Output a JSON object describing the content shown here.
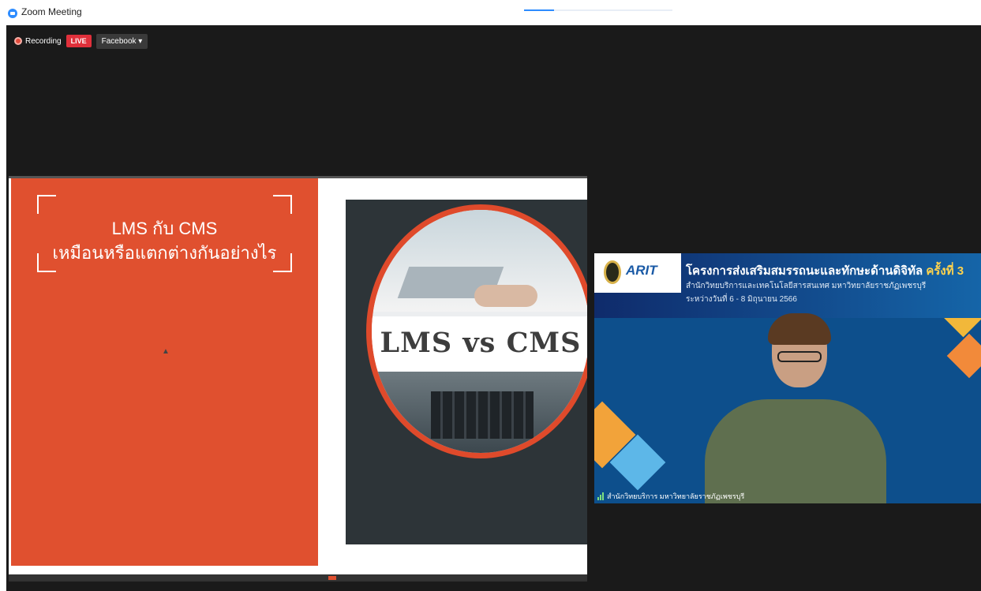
{
  "window": {
    "title": "Zoom Meeting"
  },
  "toolbar": {
    "recording_label": "Recording",
    "live_label": "LIVE",
    "stream_target": "Facebook ▾"
  },
  "slide": {
    "title_line1": "LMS กับ CMS",
    "title_line2": "เหมือนหรือแตกต่างกันอย่างไร",
    "image_text": "LMS vs CMS"
  },
  "video": {
    "logo_text": "ARIT",
    "banner_title": "โครงการส่งเสริมสมรรถนะและทักษะด้านดิจิทัล",
    "banner_title_suffix": "ครั้งที่ 3",
    "banner_sub": "สำนักวิทยบริการและเทคโนโลยีสารสนเทศ มหาวิทยาลัยราชภัฏเพชรบุรี",
    "banner_date": "ระหว่างวันที่ 6 - 8 มิถุนายน 2566",
    "participant_name": "สำนักวิทยบริการ มหาวิทยาลัยราชภัฏเพชรบุรี"
  },
  "colors": {
    "accent": "#e0502f",
    "live": "#e0303b",
    "zoom_blue": "#2d8cff"
  },
  "icons": [
    "zoom-logo-icon",
    "record-icon",
    "mouse-cursor-icon",
    "signal-bars-icon"
  ]
}
